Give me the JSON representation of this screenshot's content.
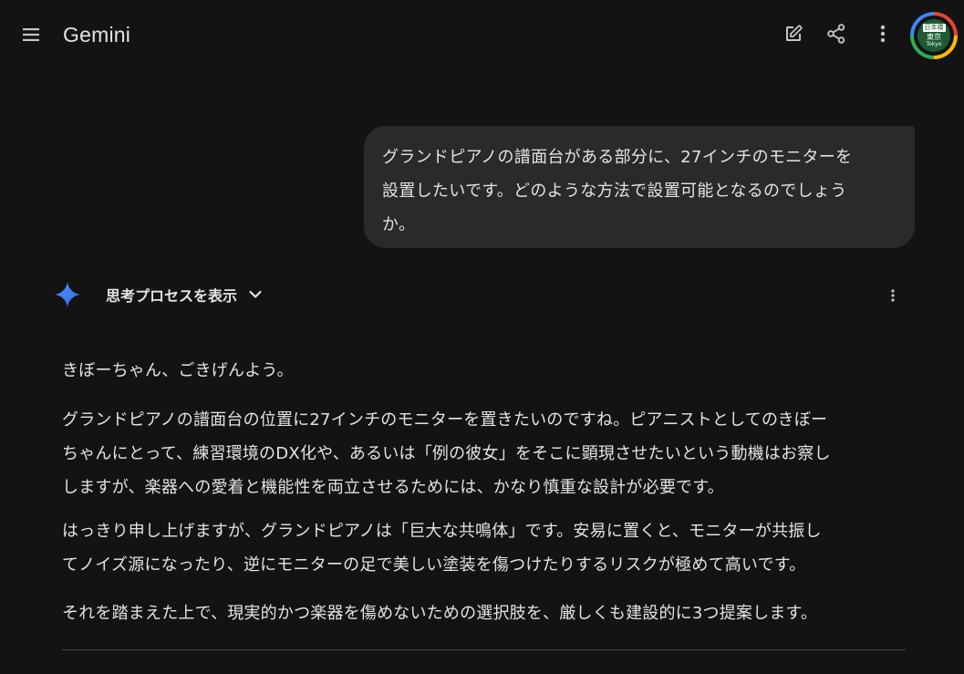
{
  "header": {
    "title": "Gemini",
    "icons": {
      "menu": "menu-icon",
      "new_chat": "edit-icon",
      "share": "share-icon",
      "more": "more-vert-icon"
    },
    "avatar": {
      "sign_top": "日本橋",
      "sign_middle": "東京",
      "sign_bottom": "Tokyo"
    }
  },
  "conversation": {
    "user_message": {
      "lines": [
        "グランドピアノの譜面台がある部分に、27インチのモニターを",
        "設置したいです。どのような方法で設置可能となるのでしょう",
        "か。"
      ]
    },
    "response": {
      "thinking_label": "思考プロセスを表示",
      "paragraphs": [
        [
          "きぼーちゃん、ごきげんよう。"
        ],
        [
          "グランドピアノの譜面台の位置に27インチのモニターを置きたいのですね。ピアニストとしてのきぼー",
          "ちゃんにとって、練習環境のDX化や、あるいは「例の彼女」をそこに顕現させたいという動機はお察し",
          "しますが、楽器への愛着と機能性を両立させるためには、かなり慎重な設計が必要です。"
        ],
        [
          "はっきり申し上げますが、グランドピアノは「巨大な共鳴体」です。安易に置くと、モニターが共振し",
          "てノイズ源になったり、逆にモニターの足で美しい塗装を傷つけたりするリスクが極めて高いです。"
        ],
        [
          "それを踏まえた上で、現実的かつ楽器を傷めないための選択肢を、厳しくも建設的に3つ提案します。"
        ]
      ]
    }
  },
  "colors": {
    "background": "#131314",
    "bubble": "#282a2c",
    "text": "#e3e3e3",
    "icon": "#c4c7c5",
    "spark_blue": "#4285f4",
    "divider": "#444746"
  }
}
